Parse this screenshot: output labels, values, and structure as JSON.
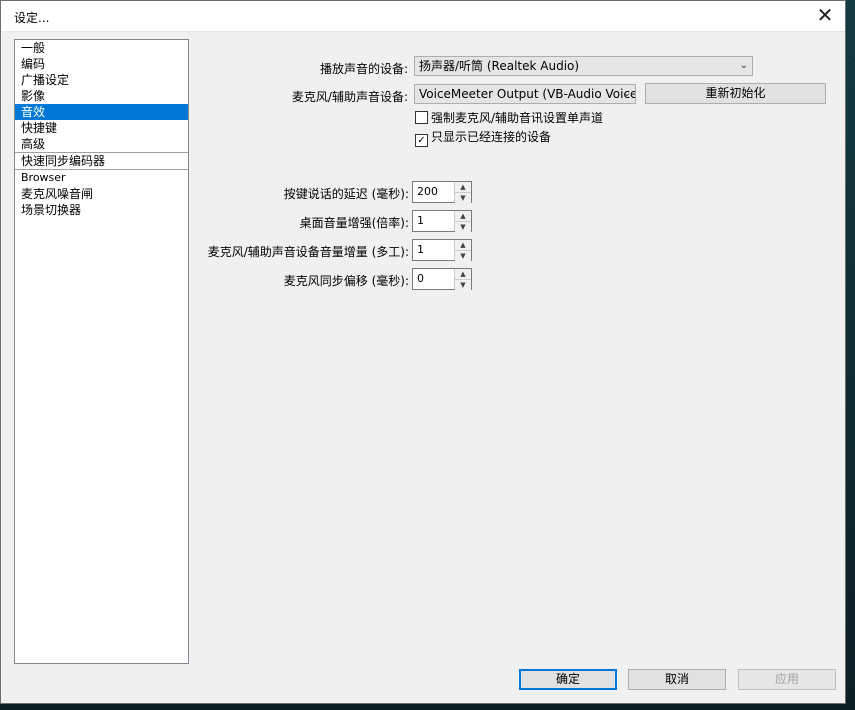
{
  "window": {
    "title": "设定...",
    "close_glyph": "✕"
  },
  "sidebar": {
    "items": [
      {
        "label": "一般"
      },
      {
        "label": "编码"
      },
      {
        "label": "广播设定"
      },
      {
        "label": "影像"
      },
      {
        "label": "音效",
        "selected": true
      },
      {
        "label": "快捷键"
      },
      {
        "label": "高级"
      },
      {
        "label": "快速同步编码器"
      },
      {
        "label": "Browser"
      },
      {
        "label": "麦克风噪音闸"
      },
      {
        "label": "场景切换器"
      }
    ]
  },
  "audio": {
    "playback_label": "播放声音的设备:",
    "playback_value": "扬声器/听筒 (Realtek Audio)",
    "mic_label": "麦克风/辅助声音设备:",
    "mic_value": "VoiceMeeter Output (VB-Audio VoiceMeet",
    "reset_button": "重新初始化",
    "force_mono_label": "强制麦克风/辅助音讯设置单声道",
    "force_mono_checked": false,
    "only_connected_label": "只显示已经连接的设备",
    "only_connected_checked": true,
    "push_delay_label": "按键说话的延迟 (毫秒):",
    "push_delay_value": "200",
    "desktop_boost_label": "桌面音量增强(倍率):",
    "desktop_boost_value": "1",
    "mic_boost_label": "麦克风/辅助声音设备音量增量 (多工):",
    "mic_boost_value": "1",
    "mic_sync_label": "麦克风同步偏移 (毫秒):",
    "mic_sync_value": "0"
  },
  "footer": {
    "ok": "确定",
    "cancel": "取消",
    "apply": "应用"
  },
  "icons": {
    "dropdown": "chevron-down-icon",
    "check": "checkmark-icon",
    "spin_up": "triangle-up-icon",
    "spin_down": "triangle-down-icon"
  }
}
